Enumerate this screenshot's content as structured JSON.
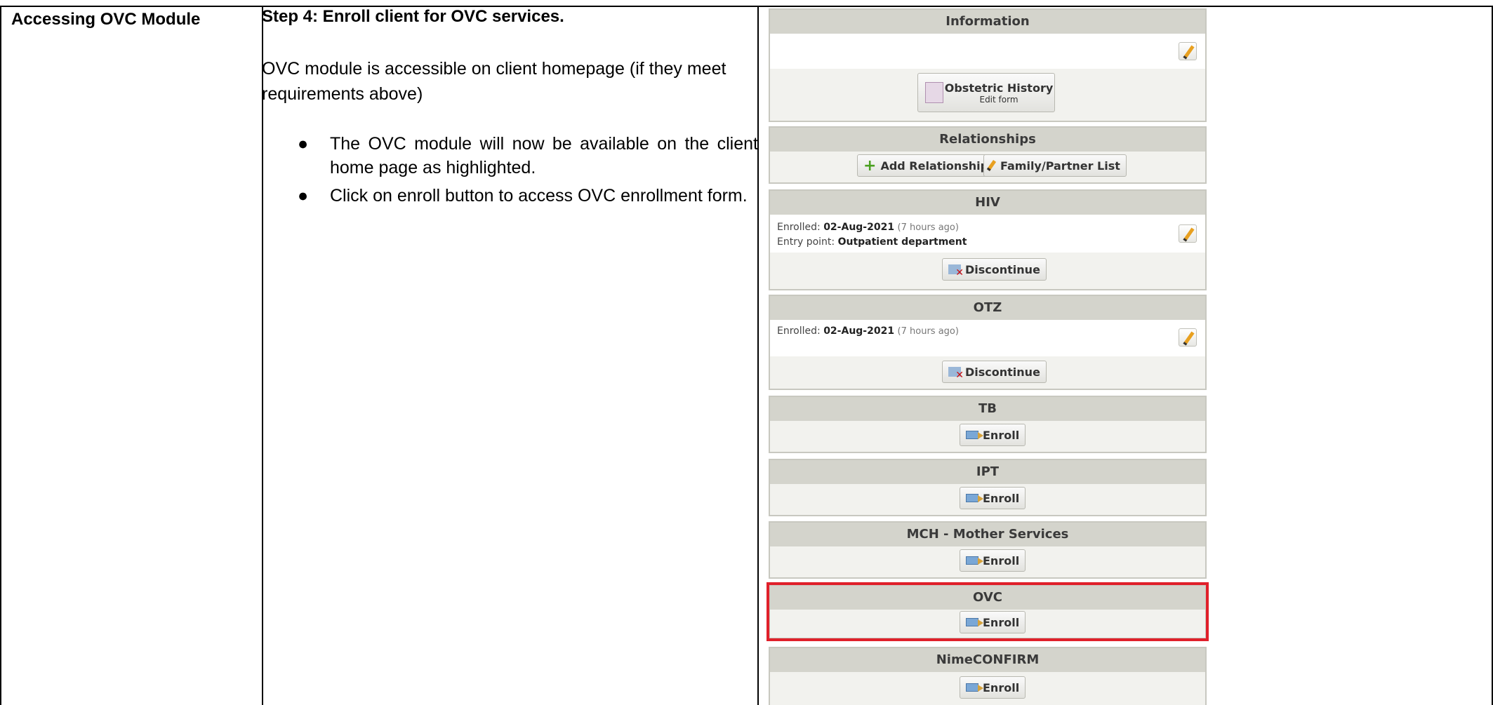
{
  "doc": {
    "section_title": "Accessing OVC Module",
    "step_title": "Step 4: Enroll client for OVC services.",
    "intro": "OVC module is accessible on client homepage (if they meet requirements above)",
    "bullets": [
      "The OVC module will now be available on the client home page as highlighted.",
      "Click on enroll button to access OVC enrollment form."
    ]
  },
  "app": {
    "information": {
      "title": "Information",
      "form_title": "Obstetric History",
      "form_sub": "Edit form"
    },
    "relationships": {
      "title": "Relationships",
      "add_label": "Add Relationship",
      "list_label": "Family/Partner List"
    },
    "hiv": {
      "title": "HIV",
      "enrolled_label": "Enrolled:",
      "enrolled_date": "02-Aug-2021",
      "enrolled_ago": "(7 hours ago)",
      "entry_label": "Entry point:",
      "entry_value": "Outpatient department",
      "discontinue_label": "Discontinue"
    },
    "otz": {
      "title": "OTZ",
      "enrolled_label": "Enrolled:",
      "enrolled_date": "02-Aug-2021",
      "enrolled_ago": "(7 hours ago)",
      "discontinue_label": "Discontinue"
    },
    "tb": {
      "title": "TB",
      "enroll_label": "Enroll"
    },
    "ipt": {
      "title": "IPT",
      "enroll_label": "Enroll"
    },
    "mch": {
      "title": "MCH - Mother Services",
      "enroll_label": "Enroll"
    },
    "ovc": {
      "title": "OVC",
      "enroll_label": "Enroll"
    },
    "nime": {
      "title": "NimeCONFIRM",
      "enroll_label": "Enroll"
    }
  },
  "colors": {
    "highlight": "#e0202a",
    "panel_header": "#d4d4cc"
  }
}
